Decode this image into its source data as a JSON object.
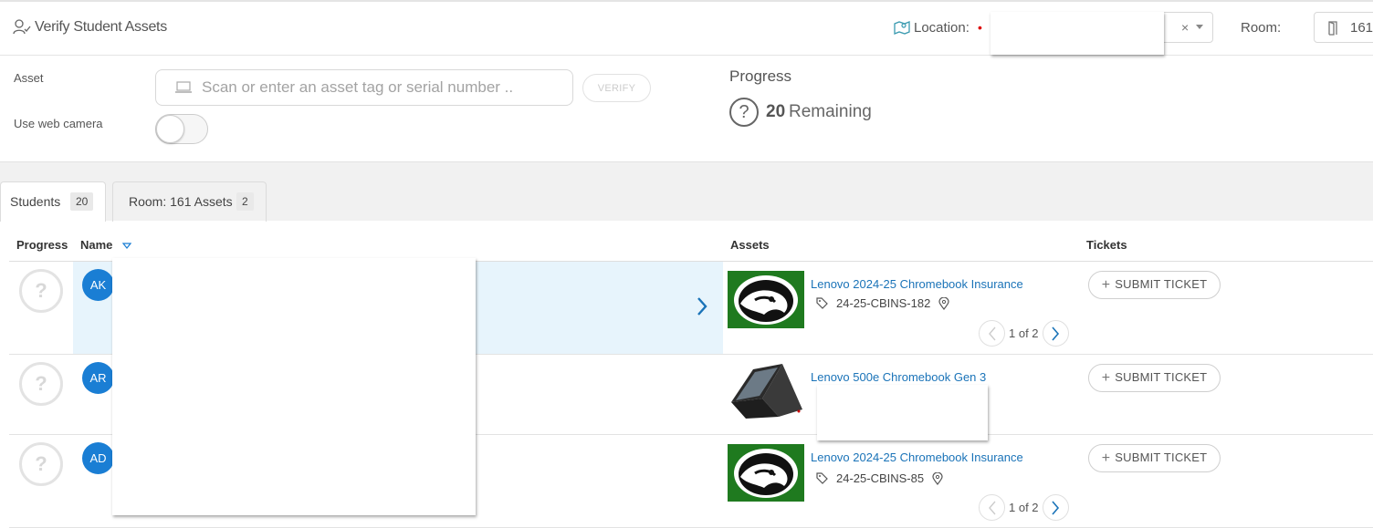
{
  "header": {
    "title": "Verify Student Assets",
    "location_label": "Location:",
    "location_required": "•",
    "location_clear": "×",
    "room_label": "Room:",
    "room_value": "161"
  },
  "verify": {
    "asset_label": "Asset",
    "asset_placeholder": "Scan or enter an asset tag or serial number ..",
    "verify_button": "VERIFY",
    "camera_label": "Use web camera",
    "camera_on": false
  },
  "progress": {
    "title": "Progress",
    "remaining_count": "20",
    "remaining_label": "Remaining"
  },
  "tabs": [
    {
      "label": "Students",
      "count": "20",
      "active": true
    },
    {
      "label": "Room: 161 Assets",
      "count": "2",
      "active": false
    }
  ],
  "table": {
    "columns": {
      "progress": "Progress",
      "name": "Name",
      "assets": "Assets",
      "tickets": "Tickets"
    },
    "rows": [
      {
        "initials": "AK",
        "status": "?",
        "selected": true,
        "asset_name": "Lenovo 2024-25 Chromebook Insurance",
        "asset_tag": "24-25-CBINS-182",
        "pager": "1 of 2",
        "thumb": "panther-logo",
        "ticket_label": "SUBMIT TICKET"
      },
      {
        "initials": "AR",
        "status": "?",
        "selected": false,
        "asset_name": "Lenovo 500e Chromebook Gen 3",
        "asset_tag": "",
        "pager": "",
        "thumb": "chromebook-photo",
        "ticket_label": "SUBMIT TICKET"
      },
      {
        "initials": "AD",
        "status": "?",
        "selected": false,
        "asset_name": "Lenovo 2024-25 Chromebook Insurance",
        "asset_tag": "24-25-CBINS-85",
        "pager": "1 of 2",
        "thumb": "panther-logo",
        "ticket_label": "SUBMIT TICKET"
      }
    ]
  },
  "colors": {
    "accent": "#1a7ed4",
    "link": "#1a73b8",
    "selected_row": "#e7f4fc",
    "logo_green": "#1f7a1f"
  }
}
